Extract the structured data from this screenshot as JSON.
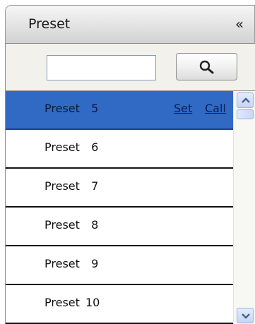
{
  "panel": {
    "title": "Preset",
    "collapse_glyph": "«"
  },
  "search": {
    "value": "",
    "placeholder": "",
    "button_icon": "search-icon"
  },
  "presets": [
    {
      "label": "Preset  5",
      "selected": true,
      "set_label": "Set",
      "call_label": "Call"
    },
    {
      "label": "Preset  6",
      "selected": false
    },
    {
      "label": "Preset  7",
      "selected": false
    },
    {
      "label": "Preset  8",
      "selected": false
    },
    {
      "label": "Preset  9",
      "selected": false
    },
    {
      "label": "Preset 10",
      "selected": false
    }
  ],
  "colors": {
    "selection": "#316ac5",
    "row_divider": "#111111",
    "header_gradient_top": "#f6f6f6",
    "header_gradient_bottom": "#d2d2d2"
  }
}
